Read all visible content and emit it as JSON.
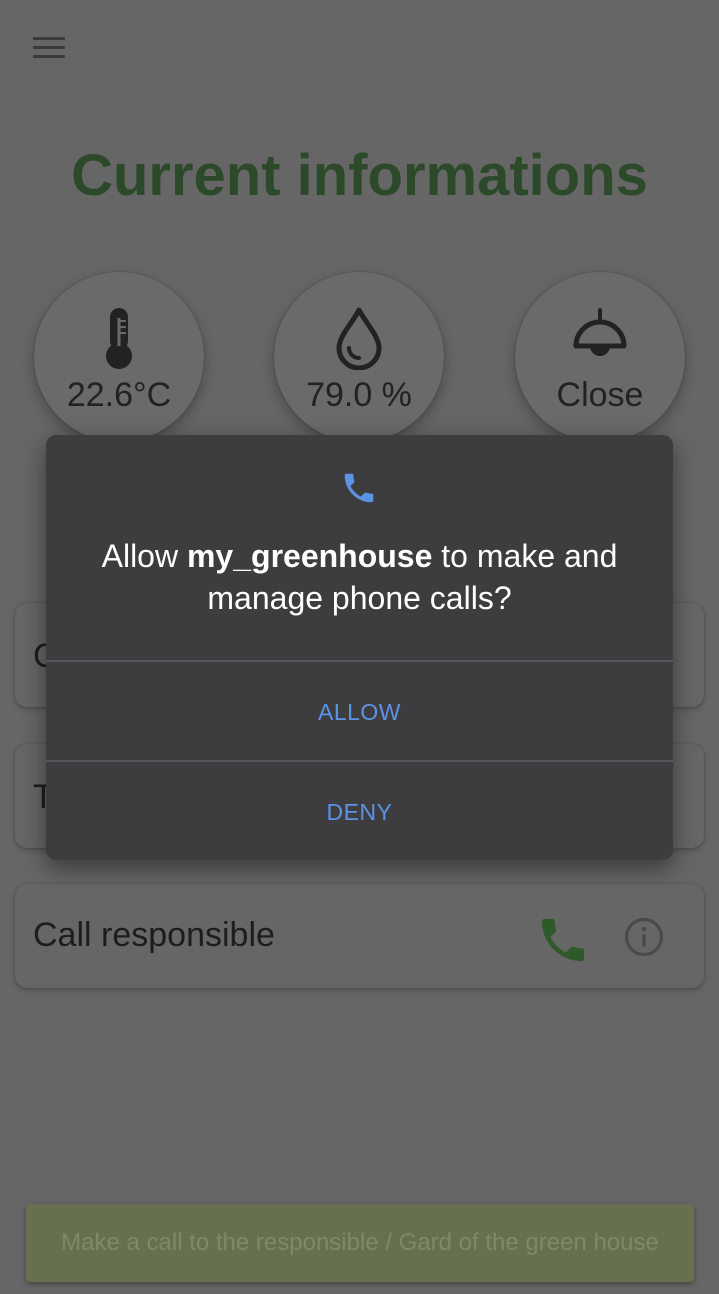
{
  "app": {
    "title": "Current informations",
    "gauges": [
      {
        "icon": "thermometer-icon",
        "value": "22.6°C"
      },
      {
        "icon": "water-drop-icon",
        "value": "79.0 %"
      },
      {
        "icon": "lamp-icon",
        "value": "Close"
      }
    ],
    "cards": [
      {
        "label_partial": "C"
      },
      {
        "label_partial": "T"
      },
      {
        "label": "Call responsible",
        "action_icon": "phone-icon",
        "info_icon": "info-icon"
      }
    ],
    "toast": "Make a call to the responsible / Gard of the green house"
  },
  "dialog": {
    "icon": "phone-icon",
    "prefix": "Allow ",
    "app_name": "my_greenhouse",
    "suffix": " to make and manage phone calls?",
    "allow_label": "ALLOW",
    "deny_label": "DENY"
  },
  "colors": {
    "title_green": "#2c4a2a",
    "accent_blue": "#5c93e5",
    "dialog_bg": "#3d3d40",
    "scrim_bg": "#666666",
    "call_green": "#2e5a2a"
  }
}
